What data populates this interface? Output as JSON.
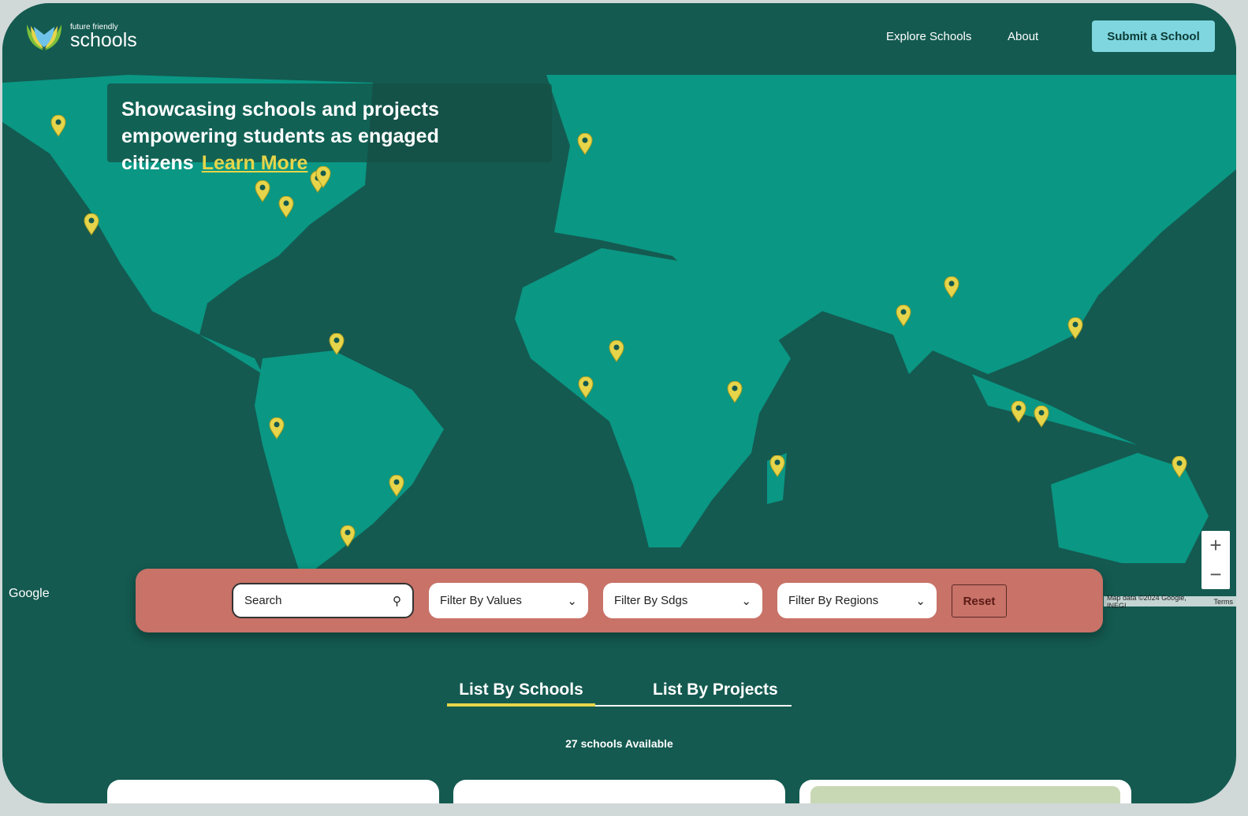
{
  "header": {
    "logo_small": "future friendly",
    "logo_big": "schools",
    "nav": [
      "Explore Schools",
      "About"
    ],
    "submit": "Submit a School"
  },
  "banner": {
    "text": "Showcasing schools and projects empowering students as engaged citizens",
    "link": "Learn More"
  },
  "map": {
    "google": "Google",
    "zoom_in": "+",
    "zoom_out": "−",
    "attribution": "Map data ©2024 Google, INEGI",
    "terms": "Terms",
    "land_color": "#0a9784",
    "ocean_color": "#145a50",
    "pin_color": "#e6d54a"
  },
  "filters": {
    "search_placeholder": "Search",
    "values": "Filter By Values",
    "sdgs": "Filter By Sdgs",
    "regions": "Filter By Regions",
    "reset": "Reset"
  },
  "tabs": [
    "List By Schools",
    "List By Projects"
  ],
  "count": "27 schools Available"
}
